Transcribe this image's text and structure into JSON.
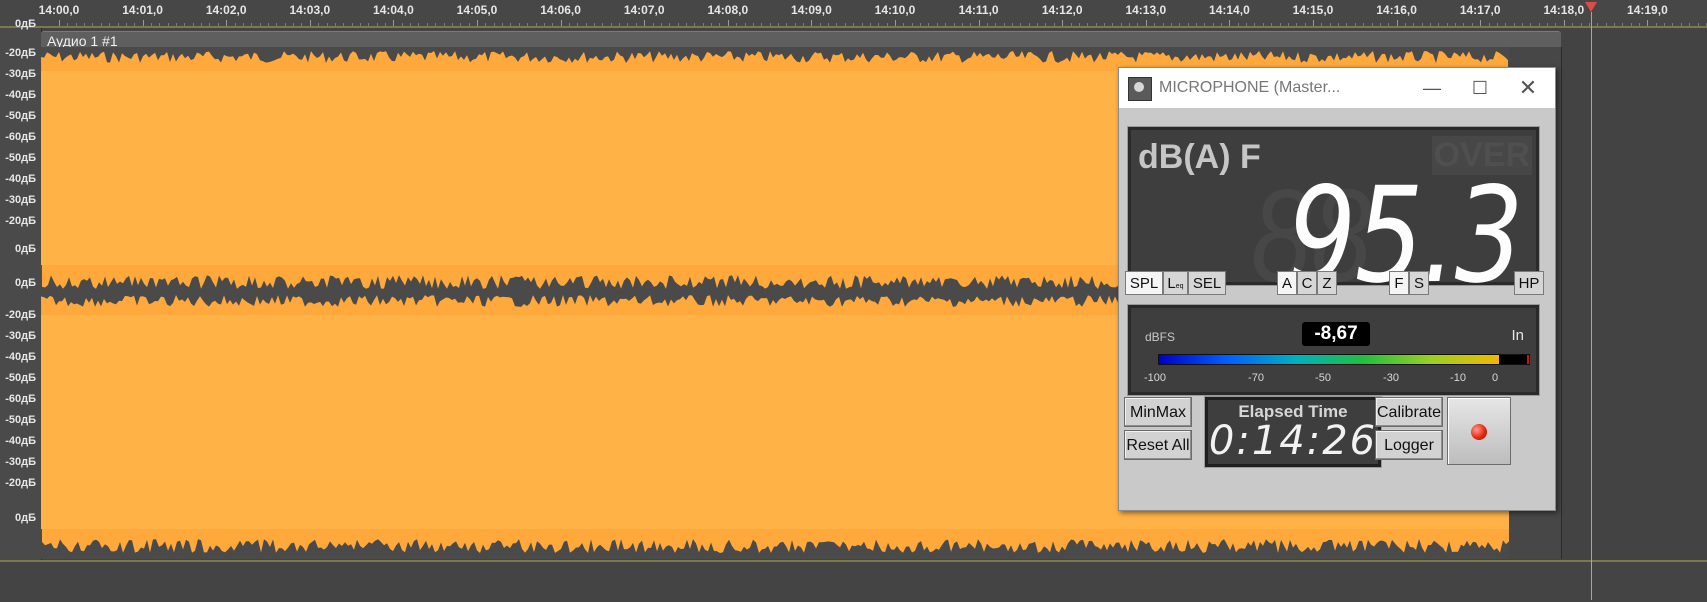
{
  "timeline": {
    "labels": [
      "14:00,0",
      "14:01,0",
      "14:02,0",
      "14:03,0",
      "14:04,0",
      "14:05,0",
      "14:06,0",
      "14:07,0",
      "14:08,0",
      "14:09,0",
      "14:10,0",
      "14:11,0",
      "14:12,0",
      "14:13,0",
      "14:14,0",
      "14:15,0",
      "14:16,0",
      "14:17,0",
      "14:18,0",
      "14:19,0"
    ]
  },
  "db_scale": {
    "channel1": [
      "0дБ",
      "-20дБ",
      "-30дБ",
      "-40дБ",
      "-50дБ",
      "-60дБ",
      "-50дБ",
      "-40дБ",
      "-30дБ",
      "-20дБ",
      "0дБ"
    ],
    "channel2": [
      "0дБ",
      "-20дБ",
      "-30дБ",
      "-40дБ",
      "-50дБ",
      "-60дБ",
      "-50дБ",
      "-40дБ",
      "-30дБ",
      "-20дБ",
      "0дБ"
    ]
  },
  "track": {
    "title": "Аудио 1 #1",
    "waveform_color": "#ffa93d",
    "waveform_dark": "#4a4a4a"
  },
  "meter_window": {
    "title": "MICROPHONE (Master...",
    "controls": {
      "minimize": "—",
      "maximize": "☐",
      "close": "✕"
    },
    "display": {
      "mode": "dB(A) F",
      "over": "OVER",
      "value": "95.3",
      "ghost": "88"
    },
    "buttons": {
      "spl": "SPL",
      "leq": "L",
      "leq_sub": "eq",
      "sel": "SEL",
      "a": "A",
      "c": "C",
      "z": "Z",
      "f": "F",
      "s": "S",
      "hp": "HP",
      "minmax": "MinMax",
      "reset_all": "Reset All",
      "calibrate": "Calibrate",
      "logger": "Logger"
    },
    "level": {
      "unit": "dBFS",
      "value": "-8,67",
      "input": "In",
      "fill_fraction": 0.92,
      "scale": [
        "-100",
        "-70",
        "-50",
        "-30",
        "-10",
        "0"
      ]
    },
    "timer": {
      "caption": "Elapsed Time",
      "value": "0:14:26"
    },
    "colors": {
      "led": "#e62a10",
      "display_bg": "#3e3e3e"
    }
  }
}
